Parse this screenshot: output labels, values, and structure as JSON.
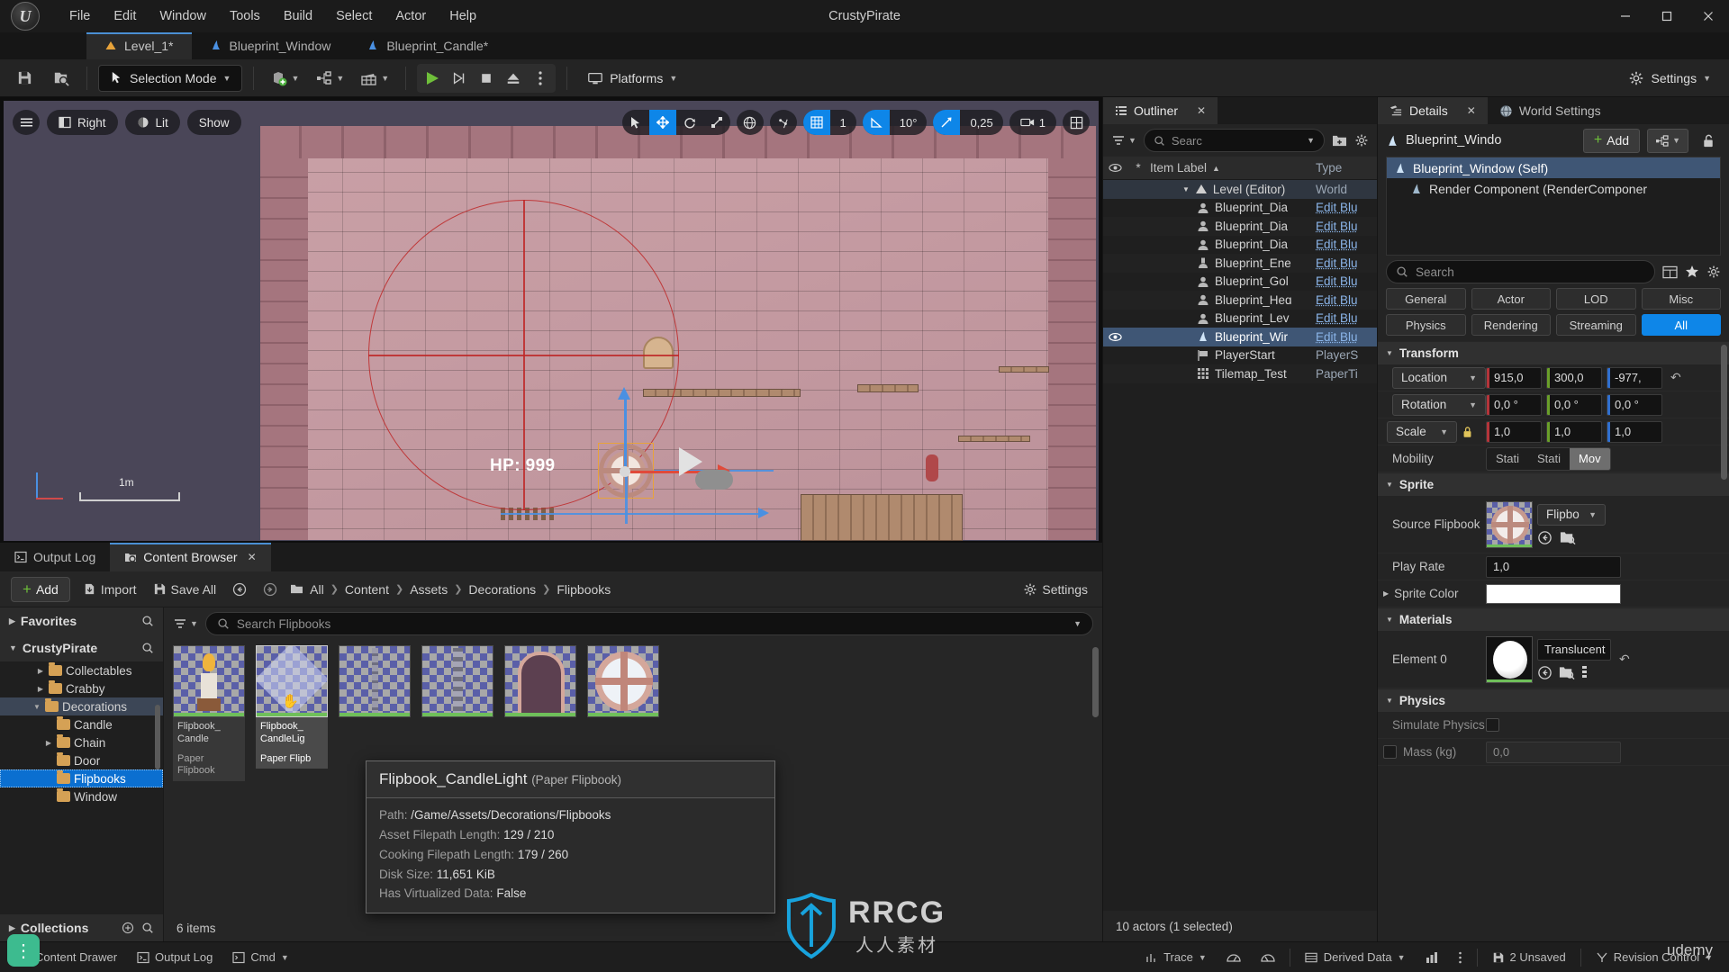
{
  "window": {
    "title": "CrustyPirate",
    "minimize_label": "—",
    "maximize_label": "❐",
    "close_label": "✕"
  },
  "menu": {
    "items": [
      "File",
      "Edit",
      "Window",
      "Tools",
      "Build",
      "Select",
      "Actor",
      "Help"
    ]
  },
  "tabs": [
    {
      "label": "Level_1*",
      "icon": "level-icon",
      "active": true
    },
    {
      "label": "Blueprint_Window",
      "icon": "blueprint-icon",
      "active": false
    },
    {
      "label": "Blueprint_Candle*",
      "icon": "blueprint-icon",
      "active": false
    }
  ],
  "toolbar": {
    "save_icon": "save-icon",
    "browse_icon": "browse-content-icon",
    "mode_label": "Selection Mode",
    "add_icon": "add-actor-icon",
    "blueprint_icon": "blueprints-icon",
    "cinematics_icon": "cinematics-icon",
    "play_icon": "play-icon",
    "skip_icon": "skip-icon",
    "stop_icon": "stop-icon",
    "eject_icon": "eject-icon",
    "more_icon": "more-options-icon",
    "platforms_label": "Platforms",
    "settings_label": "Settings"
  },
  "viewport": {
    "menu_icon": "hamburger-icon",
    "view_label": "Right",
    "lit_label": "Lit",
    "show_label": "Show",
    "select_icon": "select-arrow-icon",
    "move_icon": "move-gizmo-icon",
    "rotate_icon": "rotate-gizmo-icon",
    "scale_icon": "scale-gizmo-icon",
    "world_icon": "world-coords-icon",
    "snap_actor_icon": "surface-snap-icon",
    "grid_icon": "grid-snap-icon",
    "grid_value": "1",
    "angle_icon": "angle-snap-icon",
    "angle_value": "10°",
    "scale_snap_icon": "scale-snap-icon",
    "scale_value": "0,25",
    "camera_icon": "camera-speed-icon",
    "camera_value": "1",
    "layout_icon": "viewport-layout-icon",
    "hp_text": "HP: 999",
    "scale_label": "1m"
  },
  "outliner": {
    "tab_label": "Outliner",
    "close_icon": "close-icon",
    "tab_icon": "outliner-icon",
    "filter_icon": "filter-icon",
    "search_placeholder": "Searc",
    "new_folder_icon": "new-folder-icon",
    "settings_icon": "gear-icon",
    "columns": {
      "visibility": "eye-icon",
      "modified": "*",
      "item_label": "Item Label",
      "sort_arrow": "▲",
      "type": "Type"
    },
    "rows": [
      {
        "label": "Level (Editor)",
        "type": "World",
        "icon": "level-icon",
        "level": 0,
        "kind": "level",
        "visible": false
      },
      {
        "label": "Blueprint_Dia",
        "type": "Edit Blu",
        "icon": "actor-icon",
        "level": 1,
        "kind": "actor",
        "visible": false
      },
      {
        "label": "Blueprint_Dia",
        "type": "Edit Blu",
        "icon": "actor-icon",
        "level": 1,
        "kind": "actor",
        "visible": false
      },
      {
        "label": "Blueprint_Dia",
        "type": "Edit Blu",
        "icon": "actor-icon",
        "level": 1,
        "kind": "actor",
        "visible": false
      },
      {
        "label": "Blueprint_Ene",
        "type": "Edit Blu",
        "icon": "enemy-icon",
        "level": 1,
        "kind": "actor",
        "visible": false
      },
      {
        "label": "Blueprint_Gol",
        "type": "Edit Blu",
        "icon": "actor-icon",
        "level": 1,
        "kind": "actor",
        "visible": false
      },
      {
        "label": "Blueprint_Heɑ",
        "type": "Edit Blu",
        "icon": "actor-icon",
        "level": 1,
        "kind": "actor",
        "visible": false
      },
      {
        "label": "Blueprint_Lev",
        "type": "Edit Blu",
        "icon": "actor-icon",
        "level": 1,
        "kind": "actor",
        "visible": false
      },
      {
        "label": "Blueprint_Wir",
        "type": "Edit Blu",
        "icon": "flipbook-icon",
        "level": 1,
        "kind": "actor",
        "visible": true,
        "selected": true
      },
      {
        "label": "PlayerStart",
        "type": "PlayerS",
        "icon": "playerstart-icon",
        "level": 1,
        "kind": "actor",
        "visible": false
      },
      {
        "label": "Tilemap_Test",
        "type": "PaperTi",
        "icon": "tilemap-icon",
        "level": 1,
        "kind": "actor",
        "visible": false
      }
    ],
    "status": "10 actors (1 selected)"
  },
  "details": {
    "tabs": [
      {
        "label": "Details",
        "icon": "details-icon",
        "active": true,
        "closable": true
      },
      {
        "label": "World Settings",
        "icon": "globe-icon",
        "active": false,
        "closable": false
      }
    ],
    "close_icon": "close-icon",
    "actor_name": "Blueprint_Windo",
    "add_label": "Add",
    "components_icon": "components-icon",
    "lock_icon": "unlock-icon",
    "components": [
      {
        "label": "Blueprint_Window (Self)",
        "selected": true,
        "child": false
      },
      {
        "label": "Render Component (RenderComponer",
        "selected": false,
        "child": true
      }
    ],
    "search_placeholder": "Search",
    "column_icon": "column-layout-icon",
    "favorite_icon": "star-icon",
    "settings_icon": "gear-icon",
    "filters_row1": [
      "General",
      "Actor",
      "LOD",
      "Misc"
    ],
    "filters_row2": [
      "Physics",
      "Rendering",
      "Streaming",
      "All"
    ],
    "filter_active": "All",
    "sections": [
      {
        "title": "Transform",
        "rows": [
          {
            "name": "Location",
            "type": "vector",
            "values": [
              "915,0",
              "300,0",
              "-977,"
            ],
            "has_revert": true
          },
          {
            "name": "Rotation",
            "type": "vector",
            "values": [
              "0,0 °",
              "0,0 °",
              "0,0 °"
            ],
            "has_revert": false
          },
          {
            "name": "Scale",
            "type": "vector",
            "values": [
              "1,0",
              "1,0",
              "1,0"
            ],
            "has_revert": false,
            "locked": true
          },
          {
            "name": "Mobility",
            "type": "mobility",
            "options": [
              "Stati",
              "Stati",
              "Mov"
            ],
            "selected": "Mov"
          }
        ]
      },
      {
        "title": "Sprite",
        "rows": [
          {
            "name": "Source Flipbook",
            "type": "asset",
            "combo": "Flipbo",
            "thumb": "flipbook-window-thumb"
          },
          {
            "name": "Play Rate",
            "type": "number",
            "value": "1,0"
          },
          {
            "name": "Sprite Color",
            "type": "color",
            "value": "#ffffff"
          }
        ]
      },
      {
        "title": "Materials",
        "rows": [
          {
            "name": "Element 0",
            "type": "material",
            "value": "Translucent",
            "thumb": "material-sphere-thumb",
            "has_revert": true
          }
        ]
      },
      {
        "title": "Physics",
        "rows": [
          {
            "name": "Simulate Physics",
            "type": "checkbox",
            "checked": false,
            "dim": true
          },
          {
            "name": "Mass (kg)",
            "type": "number_checkbox",
            "value": "0,0",
            "dim": true
          }
        ]
      }
    ]
  },
  "content_browser": {
    "tabs": [
      {
        "label": "Output Log",
        "icon": "output-log-icon",
        "active": false
      },
      {
        "label": "Content Browser",
        "icon": "content-browser-icon",
        "active": true,
        "closable": true
      }
    ],
    "close_icon": "close-icon",
    "add_label": "Add",
    "import_label": "Import",
    "save_all_label": "Save All",
    "back_icon": "back-arrow-icon",
    "forward_icon": "forward-arrow-icon",
    "path_icon": "folder-icon",
    "breadcrumbs": [
      "All",
      "Content",
      "Assets",
      "Decorations",
      "Flipbooks"
    ],
    "settings_label": "Settings",
    "sidebar": {
      "favorites_label": "Favorites",
      "favorites_search_icon": "search-icon",
      "project_label": "CrustyPirate",
      "project_search_icon": "search-icon",
      "collections_label": "Collections",
      "collections_add_icon": "plus-icon",
      "collections_search_icon": "search-icon",
      "tree": [
        {
          "label": "Collectables",
          "indent": 2,
          "expandable": true,
          "selected": false
        },
        {
          "label": "Crabby",
          "indent": 2,
          "expandable": true,
          "selected": false
        },
        {
          "label": "Decorations",
          "indent": 2,
          "expandable": true,
          "expanded": true,
          "highlighted": true
        },
        {
          "label": "Candle",
          "indent": 3,
          "expandable": false,
          "selected": false
        },
        {
          "label": "Chain",
          "indent": 3,
          "expandable": true,
          "selected": false
        },
        {
          "label": "Door",
          "indent": 3,
          "expandable": false,
          "selected": false
        },
        {
          "label": "Flipbooks",
          "indent": 3,
          "expandable": false,
          "selected": true
        },
        {
          "label": "Window",
          "indent": 3,
          "expandable": false,
          "selected": false
        }
      ]
    },
    "filter_icon": "filter-icon",
    "search_placeholder": "Search Flipbooks",
    "assets": [
      {
        "name": "Flipbook_\nCandle",
        "type": "Paper Flipbook",
        "art": "candle",
        "selected": false
      },
      {
        "name": "Flipbook_\nCandleLig",
        "type": "Paper Flipb",
        "art": "candlelight",
        "selected": true
      },
      {
        "name": "",
        "type": "",
        "art": "chain1",
        "selected": false
      },
      {
        "name": "",
        "type": "",
        "art": "chain2",
        "selected": false
      },
      {
        "name": "",
        "type": "",
        "art": "door",
        "selected": false
      },
      {
        "name": "",
        "type": "",
        "art": "window",
        "selected": false
      }
    ],
    "status": "6 items"
  },
  "tooltip": {
    "title": "Flipbook_CandleLight",
    "subtitle": "(Paper Flipbook)",
    "rows": [
      {
        "label": "Path:",
        "value": "/Game/Assets/Decorations/Flipbooks"
      },
      {
        "label": "Asset Filepath Length:",
        "value": "129 / 210"
      },
      {
        "label": "Cooking Filepath Length:",
        "value": "179 / 260"
      },
      {
        "label": "Disk Size:",
        "value": "11,651 KiB"
      },
      {
        "label": "Has Virtualized Data:",
        "value": "False"
      }
    ]
  },
  "statusbar": {
    "items": [
      {
        "label": "Content Drawer",
        "icon": "drawer-icon"
      },
      {
        "label": "Output Log",
        "icon": "output-log-icon"
      },
      {
        "label": "Cmd",
        "icon": "cmd-icon",
        "caret": true
      },
      {
        "label": "Trace",
        "icon": "trace-icon",
        "caret": true
      },
      {
        "label": "",
        "icon": "perf-icon"
      },
      {
        "label": "",
        "icon": "memory-icon"
      },
      {
        "label": "Derived Data",
        "icon": "derived-data-icon",
        "caret": true
      },
      {
        "label": "",
        "icon": "stats-icon"
      },
      {
        "label": "",
        "icon": "vertical-dots-icon"
      },
      {
        "label": "2 Unsaved",
        "icon": "save-icon"
      },
      {
        "label": "Revision Control",
        "icon": "revision-control-icon",
        "caret": true
      }
    ]
  },
  "watermark": {
    "brand": "RRCG",
    "subtitle": "人人素材",
    "corner": "udemy"
  },
  "colors": {
    "accent_blue": "#0e86e8",
    "selection_blue": "#3f5675",
    "tab_underline": "#4a8fd4",
    "folder_orange": "#d5a155",
    "axis_x": "#b4343a",
    "axis_y": "#6aa02a",
    "axis_z": "#2f6fcf",
    "gizmo_orange": "#e8a33a",
    "guide_red": "#be2828"
  }
}
